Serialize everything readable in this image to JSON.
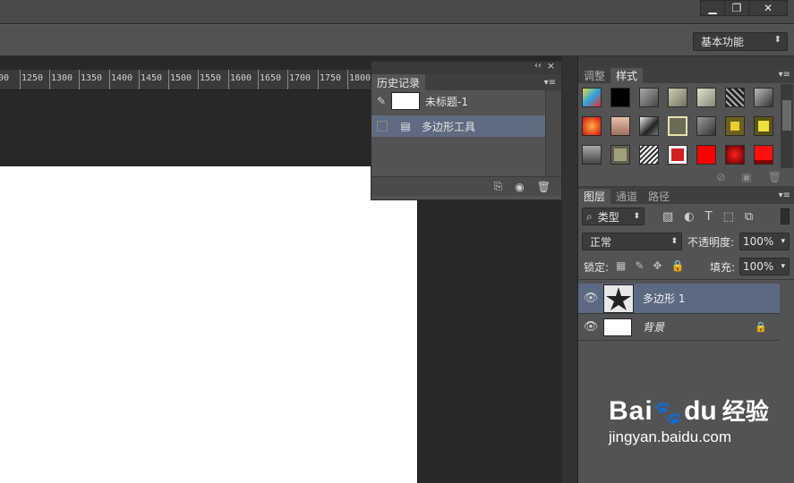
{
  "window_buttons": {
    "minimize": "▁",
    "restore": "❐",
    "close": "✕"
  },
  "options_bar": {
    "workspace": "基本功能"
  },
  "ruler": {
    "labels": [
      "00",
      "1250",
      "1300",
      "1350",
      "1400",
      "1450",
      "1500",
      "1550",
      "1600",
      "1650",
      "1700",
      "1750",
      "1800"
    ]
  },
  "history_panel": {
    "tab": "历史记录",
    "header_controls": {
      "collapse": "‹‹",
      "close": "×"
    },
    "items": [
      {
        "label": "未标题-1",
        "type": "snapshot"
      },
      {
        "label": "多边形工具",
        "type": "step",
        "selected": true
      }
    ],
    "footer_icons": [
      "new-document-from-state-icon",
      "snapshot-camera-icon",
      "trash-icon"
    ]
  },
  "styles_panel": {
    "tabs": [
      "调整",
      "样式"
    ],
    "active_tab": "样式",
    "swatches": [
      [
        "#4aa3e0",
        "#000000",
        "#6e6e6e",
        "#9a9a8a",
        "#9a9a8a",
        "#5a5a5a",
        "#7a7a7a"
      ],
      [
        "#e02020",
        "#d09a88",
        "#555555",
        "#c8c8a0",
        "#777777",
        "#e8d030",
        "#d8c820"
      ],
      [
        "#8a8a8a",
        "#9a9a80",
        "#bdbdbd",
        "#cc2020",
        "#ff0000",
        "#cc1010",
        "#ff1010"
      ]
    ]
  },
  "layers_panel": {
    "tabs": [
      "图层",
      "通道",
      "路径"
    ],
    "active_tab": "图层",
    "filter": "类型",
    "blend_mode": "正常",
    "opacity_label": "不透明度:",
    "opacity": "100%",
    "lock_label": "锁定:",
    "fill_label": "填充:",
    "fill": "100%",
    "layers": [
      {
        "name": "多边形 1",
        "selected": true,
        "italic": false
      },
      {
        "name": "背景",
        "selected": false,
        "italic": true,
        "locked": true
      }
    ]
  },
  "watermark": {
    "brand": "Bai",
    "brand2": "du",
    "cn": "经验",
    "url": "jingyan.baidu.com"
  }
}
